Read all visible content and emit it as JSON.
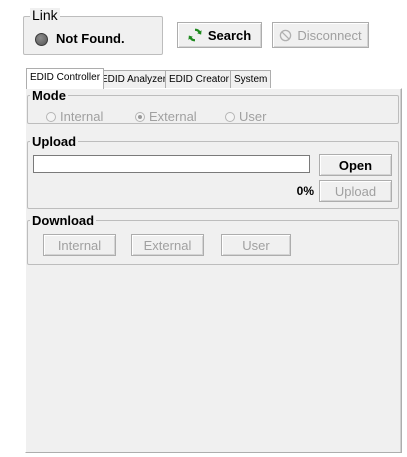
{
  "link": {
    "title": "Link",
    "status": "Not Found.",
    "status_color": "#646464"
  },
  "toolbar": {
    "search_label": "Search",
    "disconnect_label": "Disconnect"
  },
  "tabs": [
    {
      "label": "EDID Controller",
      "active": true
    },
    {
      "label": "EDID Analyzer",
      "active": false
    },
    {
      "label": "EDID Creator",
      "active": false
    },
    {
      "label": "System",
      "active": false
    }
  ],
  "mode": {
    "title": "Mode",
    "options": [
      {
        "label": "Internal",
        "checked": false
      },
      {
        "label": "External",
        "checked": true
      },
      {
        "label": "User",
        "checked": false
      }
    ]
  },
  "upload": {
    "title": "Upload",
    "file_path": "",
    "open_label": "Open",
    "progress": "0%",
    "upload_label": "Upload"
  },
  "download": {
    "title": "Download",
    "buttons": [
      "Internal",
      "External",
      "User"
    ]
  },
  "colors": {
    "panel_bg": "#f0f0f0",
    "disabled_text": "#a0a0a0",
    "search_icon": "#1f8a1f"
  }
}
